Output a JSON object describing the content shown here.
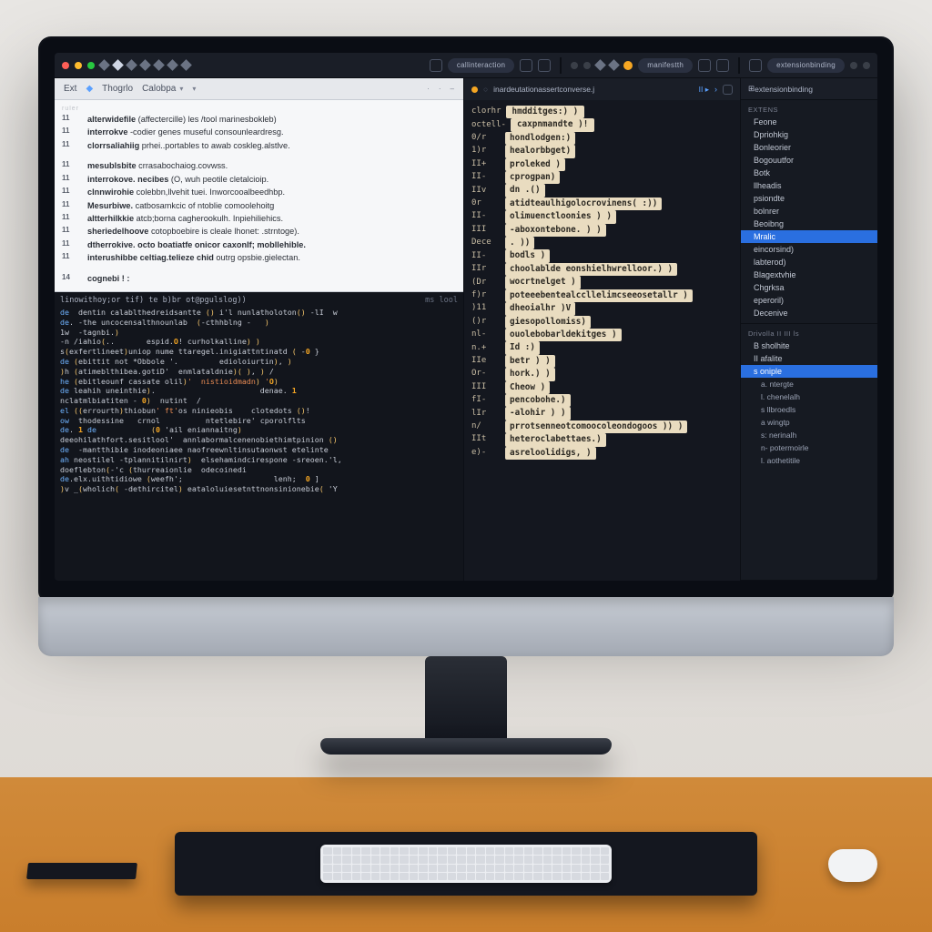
{
  "topbar": {
    "pill_left": "callinteraction",
    "pill_right_a": "manifestth",
    "pill_right_b": "extensionbinding"
  },
  "left": {
    "tabs": [
      "Ext",
      "Thogrlo",
      "Calobpa"
    ],
    "ruler": "ruler",
    "doc_lines": [
      {
        "n": "11",
        "t": "alterwidefile  (affectercille) les /tool  marinesbokleb)"
      },
      {
        "n": "11",
        "t": "interrokve  -codier  genes museful  consounleardresg."
      },
      {
        "n": "11",
        "t": "clorrsaliahiig  prhei..portables  to  awab  coskleg.alstlve."
      },
      {
        "n": "",
        "t": ""
      },
      {
        "n": "11",
        "t": "mesublsbite  crrasabochaiog.covwss."
      },
      {
        "n": "11",
        "t": "interrokove. necibes  (O,  wuh peotile cletalcioip."
      },
      {
        "n": "11",
        "t": "clnnwirohie  colebbn,llvehit tuei.  Inworcooalbeedhbp."
      },
      {
        "n": "11",
        "t": "Mesurbiwe.  catbosamkcic of  ntoblie  comoolehoitg"
      },
      {
        "n": "11",
        "t": "altterhilkkie  atcb;borna cagherookulh. Inpiehiliehics."
      },
      {
        "n": "11",
        "t": "sheriedelhoove  cotopboebire is cleale  lhonet: .strntoge)."
      },
      {
        "n": "11",
        "t": "dtherrokive. octo boatiatfe onicor caxonlf; mobllehible."
      },
      {
        "n": "11",
        "t": "interushibbe celtiag.telieze chid  outrg  opsbie.gielectan."
      },
      {
        "n": "",
        "t": ""
      },
      {
        "n": "14",
        "t": "cognebi ! :"
      }
    ],
    "code_header": "linowithoy;or tif) te b)br ot@pgulslog)) ",
    "code_footer_label": "ms  lool",
    "code_lines": [
      "de  dentin calablthedreidsantte () i'l nunlatholoton() -lI  w",
      "de. -the uncocensalthnounlab  (-cthhblng -   )",
      "1w  -tagnbi.)",
      "-n /iahio(..       espid.O! curholkalline) )",
      "s(exfertlineet)uniop nume ttaregel.inigiattntinatd ( -0 }",
      "de (ebittit not *Obbole '.         edioloiurtin), )",
      ")h (atimeblthibea.gotiD'  enmlataldnie)( ), ) /",
      "he (ebitleounf cassate olil)'  nistioidmadn) 'O)",
      "de leahih uneinthie).                       denae. 1",
      "nclatmlbiatiten - 0)  nutint  /",
      "el ((errourth)thiobun' ft'os ninieobis    clotedots ()!",
      "ow  thodessine   crnol          ntetlebire' cporolflts",
      "de. 1 de            (0 'ail eniannaitng)",
      "deeohilathfort.sesitlool'  annlabormalcenenobiethimtpinion ()",
      "de  -mantthibie inodeoniaee naofreewnltinsutaonwst etelinte",
      "ah neostilel -tplannitilnirt)  elsehamindcirespone -sreoen.'l,",
      "doeflebton(-'c (thurreaionlie  odecoinedi",
      "de.elx.uithtidiowe (weefh';                    lenh;  0 ]",
      ")v _(wholich( -dethircitel) eataloluiesetnttnonsinionebie( 'Y"
    ]
  },
  "mid": {
    "tab_title": "inardeutationassertconverse.j",
    "first_two": [
      {
        "pre": "clorhr",
        "tok": "hmdditges:) )"
      },
      {
        "pre": "octell-",
        "tok": "caxpnmandte )!"
      }
    ],
    "lines": [
      {
        "pre": "0/r",
        "tok": "hondlodgen:)"
      },
      {
        "pre": "1)r",
        "tok": "healorbbget)"
      },
      {
        "pre": "II+",
        "tok": "proleked )"
      },
      {
        "pre": "II-",
        "tok": "cprogpan)"
      },
      {
        "pre": "IIv",
        "tok": "dn .()"
      },
      {
        "pre": "0r",
        "tok": "atidteaulhigolocrovinens( :))"
      },
      {
        "pre": "II-",
        "tok": "olimuenctloonies ) )"
      },
      {
        "pre": "III",
        "tok": "-aboxontebone. ) )"
      },
      {
        "pre": "Dece",
        "tok": ". ))"
      },
      {
        "pre": "II-",
        "tok": "bodls )"
      },
      {
        "pre": "IIr",
        "tok": "choolablde eonshielhwrelloor.) )"
      },
      {
        "pre": "(Dr",
        "tok": "wocrtnelget )"
      },
      {
        "pre": "f)r",
        "tok": "poteeebentealccllelimcseeosetallr )"
      },
      {
        "pre": ")11",
        "tok": "dheoialhr )V"
      },
      {
        "pre": "()r",
        "tok": "giesopollomiss)"
      },
      {
        "pre": "nl-",
        "tok": "ouolebobarldekitges )"
      },
      {
        "pre": "n.+",
        "tok": "Id :)"
      },
      {
        "pre": "IIe",
        "tok": "betr ) )"
      },
      {
        "pre": "Or-",
        "tok": "hork.) )"
      },
      {
        "pre": "III",
        "tok": "Cheow )"
      },
      {
        "pre": "fI-",
        "tok": "pencobohe.)"
      },
      {
        "pre": "lIr",
        "tok": "-alohir ) )"
      },
      {
        "pre": "n/",
        "tok": "prrotsenneotcomoocoleondogoos )) )"
      },
      {
        "pre": "IIt",
        "tok": "heteroclabettaes.)"
      },
      {
        "pre": "e)-",
        "tok": "asreloolidigs, )"
      }
    ]
  },
  "right": {
    "header": "extensionbinding",
    "section1_label": "EXTENS",
    "section1": [
      "Feone",
      "Dpriohkig",
      "Bonleorier",
      "Bogouutfor",
      "Botk",
      "llheadis",
      "psiondte",
      "bolnrer",
      "Beoibng"
    ],
    "section1_selected": "Mralic",
    "section1_tail": [
      "eincorsind)",
      "labterod)",
      "Blagextvhie",
      "Chgrksa",
      "eperoril)",
      "Decenive"
    ],
    "section2_label": "Drivolla  II  III  ls",
    "section2": [
      "B  sholhite",
      "II   afalite"
    ],
    "section2_selected": "s   oniple",
    "section2_tail": [
      "a.  ntergte",
      "l.  chenelalh",
      "s   llbroedls",
      "a    wingtp",
      "s:   nerinalh",
      "n- potermoirle",
      "l.  aothetitile"
    ]
  }
}
